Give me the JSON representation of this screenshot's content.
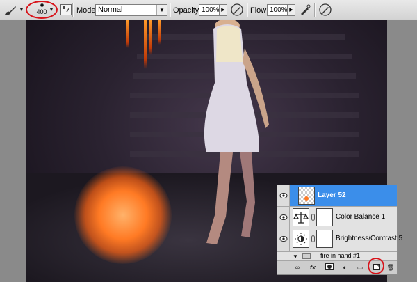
{
  "options_bar": {
    "brush_size": "400",
    "mode_label": "Mode:",
    "mode_value": "Normal",
    "opacity_label": "Opacity:",
    "opacity_value": "100%",
    "flow_label": "Flow:",
    "flow_value": "100%"
  },
  "colors": {
    "selection_blue": "#3b8eea",
    "highlight_red": "#d8141b",
    "fire_orange": "#ff7a24"
  },
  "layers_panel": {
    "layers": [
      {
        "name": "Layer 52",
        "selected": true,
        "icon": "transparent-thumbnail"
      },
      {
        "name": "Color Balance 1",
        "selected": false,
        "icon": "balance-scale-icon"
      },
      {
        "name": "Brightness/Contrast 5",
        "selected": false,
        "icon": "sun-icon"
      }
    ],
    "group": {
      "name": "fire in hand #1"
    },
    "footer_icons": [
      "link-icon",
      "fx-icon",
      "mask-icon",
      "adjustment-icon",
      "group-folder-icon",
      "new-layer-icon",
      "trash-icon"
    ]
  }
}
